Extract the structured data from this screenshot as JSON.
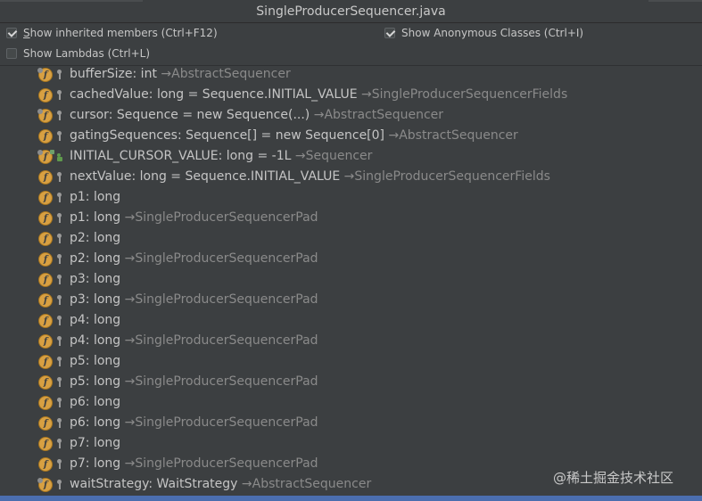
{
  "window": {
    "title": "SingleProducerSequencer.java"
  },
  "options": {
    "inherited": {
      "label": "Show inherited members (Ctrl+F12)",
      "underline_char": "S",
      "rest": "how inherited members (Ctrl+F12)",
      "checked": true
    },
    "anonymous": {
      "label": "Show Anonymous Classes (Ctrl+I)",
      "checked": true
    },
    "lambdas": {
      "label": "Show Lambdas (Ctrl+L)",
      "checked": false
    }
  },
  "members": [
    {
      "text": "bufferSize: int ",
      "origin": "→AbstractSequencer",
      "icon": "field-inherited-icon"
    },
    {
      "text": "cachedValue: long = Sequence.INITIAL_VALUE ",
      "origin": "→SingleProducerSequencerFields",
      "icon": "field-icon"
    },
    {
      "text": "cursor: Sequence = new Sequence(...) ",
      "origin": "→AbstractSequencer",
      "icon": "field-inherited-icon"
    },
    {
      "text": "gatingSequences: Sequence[] = new Sequence[0] ",
      "origin": "→AbstractSequencer",
      "icon": "field-icon"
    },
    {
      "text": "INITIAL_CURSOR_VALUE: long = -1L ",
      "origin": "→Sequencer",
      "icon": "static-field-icon"
    },
    {
      "text": "nextValue: long = Sequence.INITIAL_VALUE ",
      "origin": "→SingleProducerSequencerFields",
      "icon": "field-icon"
    },
    {
      "text": "p1: long",
      "origin": "",
      "icon": "field-icon"
    },
    {
      "text": "p1: long ",
      "origin": "→SingleProducerSequencerPad",
      "icon": "field-icon"
    },
    {
      "text": "p2: long",
      "origin": "",
      "icon": "field-icon"
    },
    {
      "text": "p2: long ",
      "origin": "→SingleProducerSequencerPad",
      "icon": "field-icon"
    },
    {
      "text": "p3: long",
      "origin": "",
      "icon": "field-icon"
    },
    {
      "text": "p3: long ",
      "origin": "→SingleProducerSequencerPad",
      "icon": "field-icon"
    },
    {
      "text": "p4: long",
      "origin": "",
      "icon": "field-icon"
    },
    {
      "text": "p4: long ",
      "origin": "→SingleProducerSequencerPad",
      "icon": "field-icon"
    },
    {
      "text": "p5: long",
      "origin": "",
      "icon": "field-icon"
    },
    {
      "text": "p5: long ",
      "origin": "→SingleProducerSequencerPad",
      "icon": "field-icon"
    },
    {
      "text": "p6: long",
      "origin": "",
      "icon": "field-icon"
    },
    {
      "text": "p6: long ",
      "origin": "→SingleProducerSequencerPad",
      "icon": "field-icon"
    },
    {
      "text": "p7: long",
      "origin": "",
      "icon": "field-icon"
    },
    {
      "text": "p7: long ",
      "origin": "→SingleProducerSequencerPad",
      "icon": "field-icon"
    },
    {
      "text": "waitStrategy: WaitStrategy ",
      "origin": "→AbstractSequencer",
      "icon": "field-inherited-icon"
    }
  ],
  "icon_letter": "f",
  "watermark": "@稀土掘金技术社区",
  "colors": {
    "background": "#3c3f41",
    "field_icon": "#d8a042",
    "origin_text": "#8a8a8a",
    "selection": "#4b6eaf"
  }
}
